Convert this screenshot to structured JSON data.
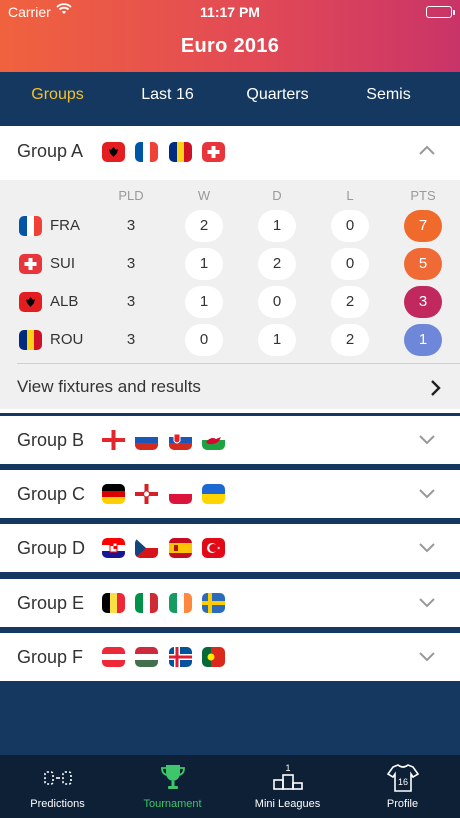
{
  "status": {
    "carrier": "Carrier",
    "time": "11:17 PM"
  },
  "app_title": "Euro 2016",
  "tabs": [
    {
      "label": "Groups",
      "active": true
    },
    {
      "label": "Last 16",
      "active": false
    },
    {
      "label": "Quarters",
      "active": false
    },
    {
      "label": "Semis",
      "active": false
    }
  ],
  "columns": {
    "pld": "PLD",
    "w": "W",
    "d": "D",
    "l": "L",
    "pts": "PTS"
  },
  "groups": [
    {
      "name": "Group A",
      "flags": [
        "Albania",
        "France",
        "Romania",
        "Switzerland"
      ],
      "expanded": true
    },
    {
      "name": "Group B",
      "flags": [
        "England",
        "Russia",
        "Slovakia",
        "Wales"
      ],
      "expanded": false
    },
    {
      "name": "Group C",
      "flags": [
        "Germany",
        "Northern Ireland",
        "Poland",
        "Ukraine"
      ],
      "expanded": false
    },
    {
      "name": "Group D",
      "flags": [
        "Croatia",
        "Czech Republic",
        "Spain",
        "Turkey"
      ],
      "expanded": false
    },
    {
      "name": "Group E",
      "flags": [
        "Belgium",
        "Italy",
        "Ireland",
        "Sweden"
      ],
      "expanded": false
    },
    {
      "name": "Group F",
      "flags": [
        "Austria",
        "Hungary",
        "Iceland",
        "Portugal"
      ],
      "expanded": false
    }
  ],
  "standings": [
    {
      "team": "FRA",
      "flag": "France",
      "pld": "3",
      "w": "2",
      "d": "1",
      "l": "0",
      "pts": "7",
      "pts_color": "#f06a2b"
    },
    {
      "team": "SUI",
      "flag": "Switzerland",
      "pld": "3",
      "w": "1",
      "d": "2",
      "l": "0",
      "pts": "5",
      "pts_color": "#ef6a34"
    },
    {
      "team": "ALB",
      "flag": "Albania",
      "pld": "3",
      "w": "1",
      "d": "0",
      "l": "2",
      "pts": "3",
      "pts_color": "#c1285e"
    },
    {
      "team": "ROU",
      "flag": "Romania",
      "pld": "3",
      "w": "0",
      "d": "1",
      "l": "2",
      "pts": "1",
      "pts_color": "#6e87d8"
    }
  ],
  "fixtures_label": "View fixtures and results",
  "tabbar": [
    {
      "label": "Predictions",
      "icon": "scoreboard-icon",
      "active": false
    },
    {
      "label": "Tournament",
      "icon": "trophy-icon",
      "active": true
    },
    {
      "label": "Mini Leagues",
      "icon": "podium-icon",
      "active": false
    },
    {
      "label": "Profile",
      "icon": "jersey-icon",
      "active": false
    }
  ],
  "colors": {
    "accent": "#f2c230",
    "nav": "#14385f",
    "active_tab": "#3ec66b"
  }
}
